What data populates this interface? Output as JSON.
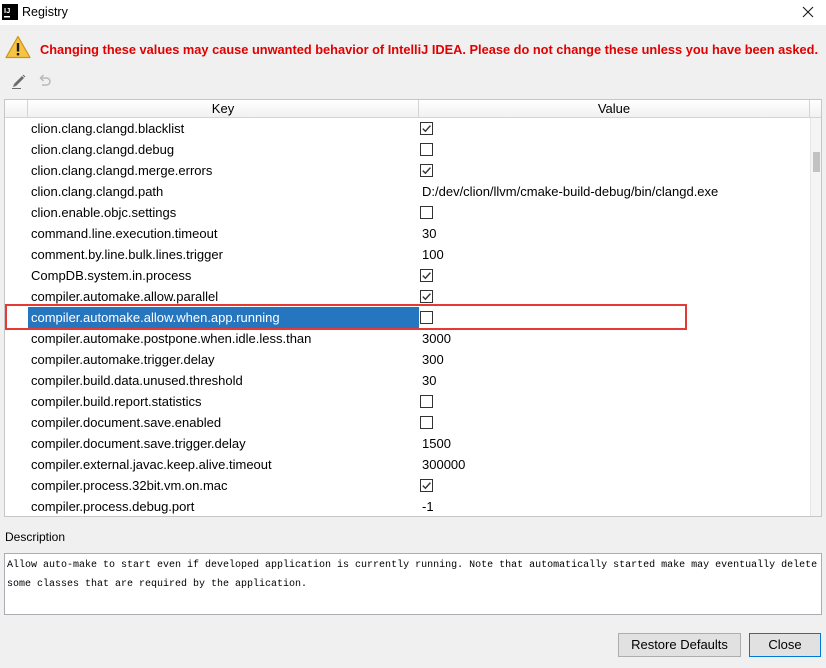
{
  "window": {
    "title": "Registry",
    "logo_text": "IJ"
  },
  "icons": {
    "app": "intellij-idea-icon",
    "close": "close-icon",
    "warning": "warning-triangle-icon",
    "edit": "edit-icon",
    "revert": "revert-icon",
    "checkbox": "checkbox-icon"
  },
  "warning": {
    "text": "Changing these values may cause unwanted behavior of IntelliJ IDEA. Please do not change these unless you have been asked."
  },
  "toolbar": {
    "edit_enabled": true,
    "revert_enabled": false
  },
  "table": {
    "header": {
      "key": "Key",
      "value": "Value"
    },
    "selected_row": 9,
    "highlighted_row": 9,
    "rows": [
      {
        "key": "clion.clang.clangd.blacklist",
        "value": true
      },
      {
        "key": "clion.clang.clangd.debug",
        "value": false
      },
      {
        "key": "clion.clang.clangd.merge.errors",
        "value": true
      },
      {
        "key": "clion.clang.clangd.path",
        "value": "D:/dev/clion/llvm/cmake-build-debug/bin/clangd.exe"
      },
      {
        "key": "clion.enable.objc.settings",
        "value": false
      },
      {
        "key": "command.line.execution.timeout",
        "value": "30"
      },
      {
        "key": "comment.by.line.bulk.lines.trigger",
        "value": "100"
      },
      {
        "key": "CompDB.system.in.process",
        "value": true
      },
      {
        "key": "compiler.automake.allow.parallel",
        "value": true
      },
      {
        "key": "compiler.automake.allow.when.app.running",
        "value": false
      },
      {
        "key": "compiler.automake.postpone.when.idle.less.than",
        "value": "3000"
      },
      {
        "key": "compiler.automake.trigger.delay",
        "value": "300"
      },
      {
        "key": "compiler.build.data.unused.threshold",
        "value": "30"
      },
      {
        "key": "compiler.build.report.statistics",
        "value": false
      },
      {
        "key": "compiler.document.save.enabled",
        "value": false
      },
      {
        "key": "compiler.document.save.trigger.delay",
        "value": "1500"
      },
      {
        "key": "compiler.external.javac.keep.alive.timeout",
        "value": "300000"
      },
      {
        "key": "compiler.process.32bit.vm.on.mac",
        "value": true
      },
      {
        "key": "compiler.process.debug.port",
        "value": "-1"
      }
    ]
  },
  "description": {
    "label": "Description",
    "text": "Allow auto-make to start even if developed application is currently running. Note that automatically started make may eventually delete some classes that are required by the application."
  },
  "buttons": {
    "restore_defaults": "Restore Defaults",
    "close": "Close",
    "focused": "close"
  },
  "colors": {
    "selection": "#2675bf",
    "warning_text": "#e00000",
    "annotation_border": "#e53935",
    "focus_border": "#0078d7"
  }
}
